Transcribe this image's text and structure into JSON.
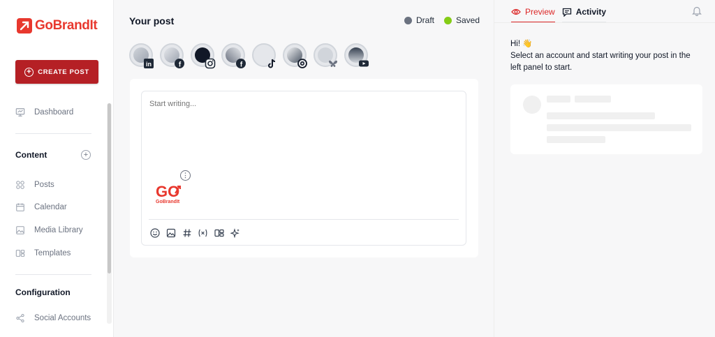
{
  "brand": {
    "name": "GoBrandIt",
    "color": "#e8382e"
  },
  "sidebar": {
    "create_label": "CREATE POST",
    "dashboard": "Dashboard",
    "content_title": "Content",
    "items": [
      "Posts",
      "Calendar",
      "Media Library",
      "Templates"
    ],
    "config_title": "Configuration",
    "social_accounts": "Social Accounts"
  },
  "main": {
    "title": "Your post",
    "status_draft": "Draft",
    "status_saved": "Saved",
    "status_colors": {
      "draft": "#6b7280",
      "saved": "#84cc16"
    },
    "accounts": [
      {
        "network": "linkedin-icon"
      },
      {
        "network": "facebook-icon"
      },
      {
        "network": "instagram-icon"
      },
      {
        "network": "facebook-icon"
      },
      {
        "network": "tiktok-icon"
      },
      {
        "network": "threads-icon"
      },
      {
        "network": "bluesky-icon"
      },
      {
        "network": "youtube-icon"
      }
    ],
    "editor": {
      "placeholder": "Start writing...",
      "media_caption": "GoBrandIt"
    }
  },
  "right": {
    "tab_preview": "Preview",
    "tab_activity": "Activity",
    "greeting": "Hi! 👋",
    "hint": "Select an account and start writing your post in the left panel to start."
  }
}
